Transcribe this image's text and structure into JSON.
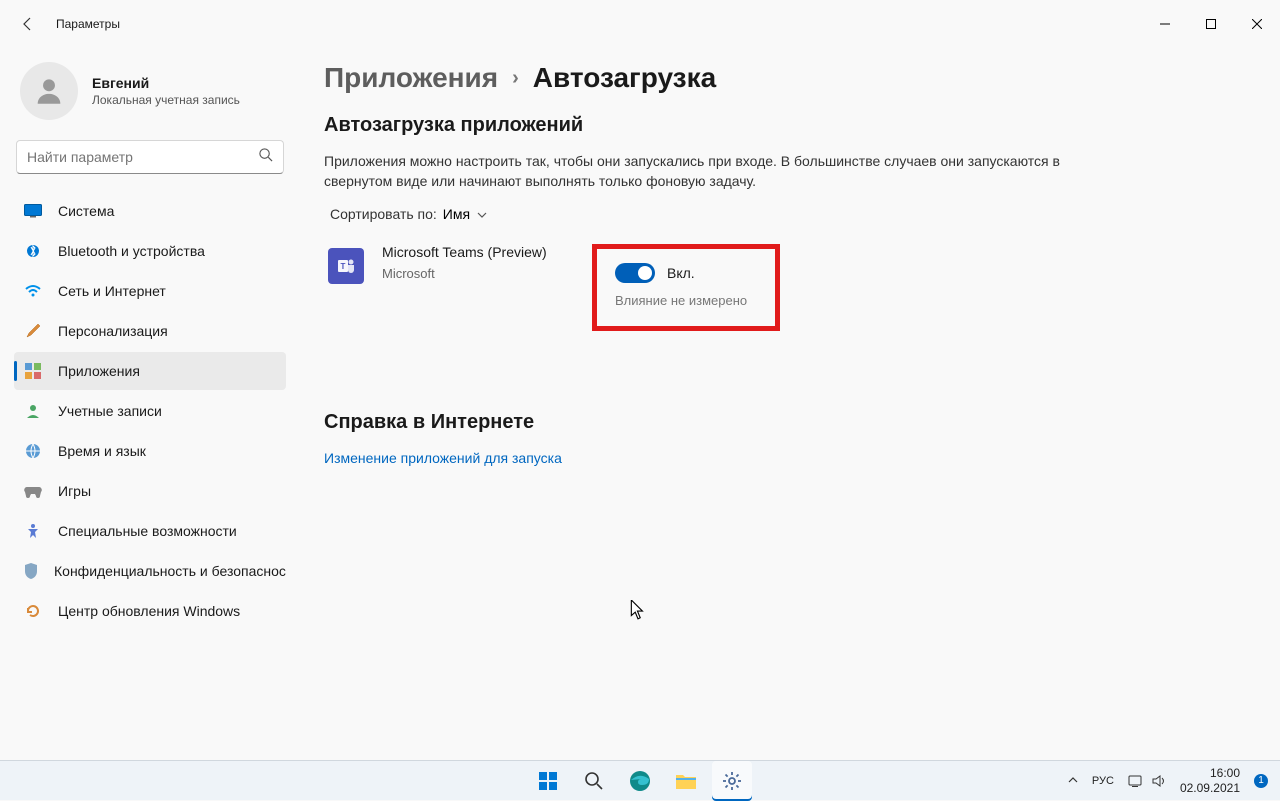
{
  "window": {
    "title": "Параметры"
  },
  "profile": {
    "name": "Евгений",
    "subtitle": "Локальная учетная запись"
  },
  "search": {
    "placeholder": "Найти параметр"
  },
  "nav": {
    "items": [
      {
        "label": "Система"
      },
      {
        "label": "Bluetooth и устройства"
      },
      {
        "label": "Сеть и Интернет"
      },
      {
        "label": "Персонализация"
      },
      {
        "label": "Приложения"
      },
      {
        "label": "Учетные записи"
      },
      {
        "label": "Время и язык"
      },
      {
        "label": "Игры"
      },
      {
        "label": "Специальные возможности"
      },
      {
        "label": "Конфиденциальность и безопасность"
      },
      {
        "label": "Центр обновления Windows"
      }
    ]
  },
  "breadcrumb": {
    "parent": "Приложения",
    "current": "Автозагрузка"
  },
  "section": {
    "title": "Автозагрузка приложений",
    "description": "Приложения можно настроить так, чтобы они запускались при входе. В большинстве случаев они запускаются в свернутом виде или начинают выполнять только фоновую задачу.",
    "sort_label": "Сортировать по:",
    "sort_value": "Имя"
  },
  "apps": [
    {
      "name": "Microsoft Teams (Preview)",
      "publisher": "Microsoft",
      "toggle_label": "Вкл.",
      "impact": "Влияние не измерено"
    }
  ],
  "help": {
    "title": "Справка в Интернете",
    "link": "Изменение приложений для запуска"
  },
  "taskbar": {
    "lang": "РУС",
    "time": "16:00",
    "date": "02.09.2021",
    "notif_count": "1"
  }
}
